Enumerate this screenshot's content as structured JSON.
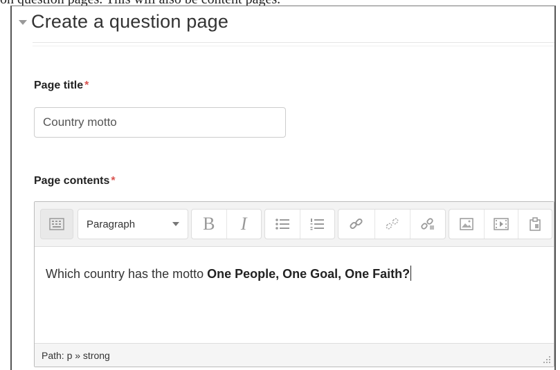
{
  "caption": "on question pages. This will also be content pages.",
  "section": {
    "title": "Create a question page"
  },
  "page_title": {
    "label": "Page title",
    "required": "*",
    "value": "Country motto"
  },
  "page_contents": {
    "label": "Page contents",
    "required": "*",
    "toolbar": {
      "toggle_icon": "keyboard-toggle-icon",
      "paragraph_label": "Paragraph",
      "bold_label": "B",
      "italic_label": "I",
      "buttons": [
        "unordered-list-icon",
        "ordered-list-icon",
        "link-icon",
        "unlink-icon",
        "nolink-icon",
        "image-icon",
        "media-icon",
        "manage-files-icon"
      ]
    },
    "text_plain": "Which country has the motto ",
    "text_bold": "One People, One Goal, One Faith?",
    "path": "Path: p » strong"
  }
}
